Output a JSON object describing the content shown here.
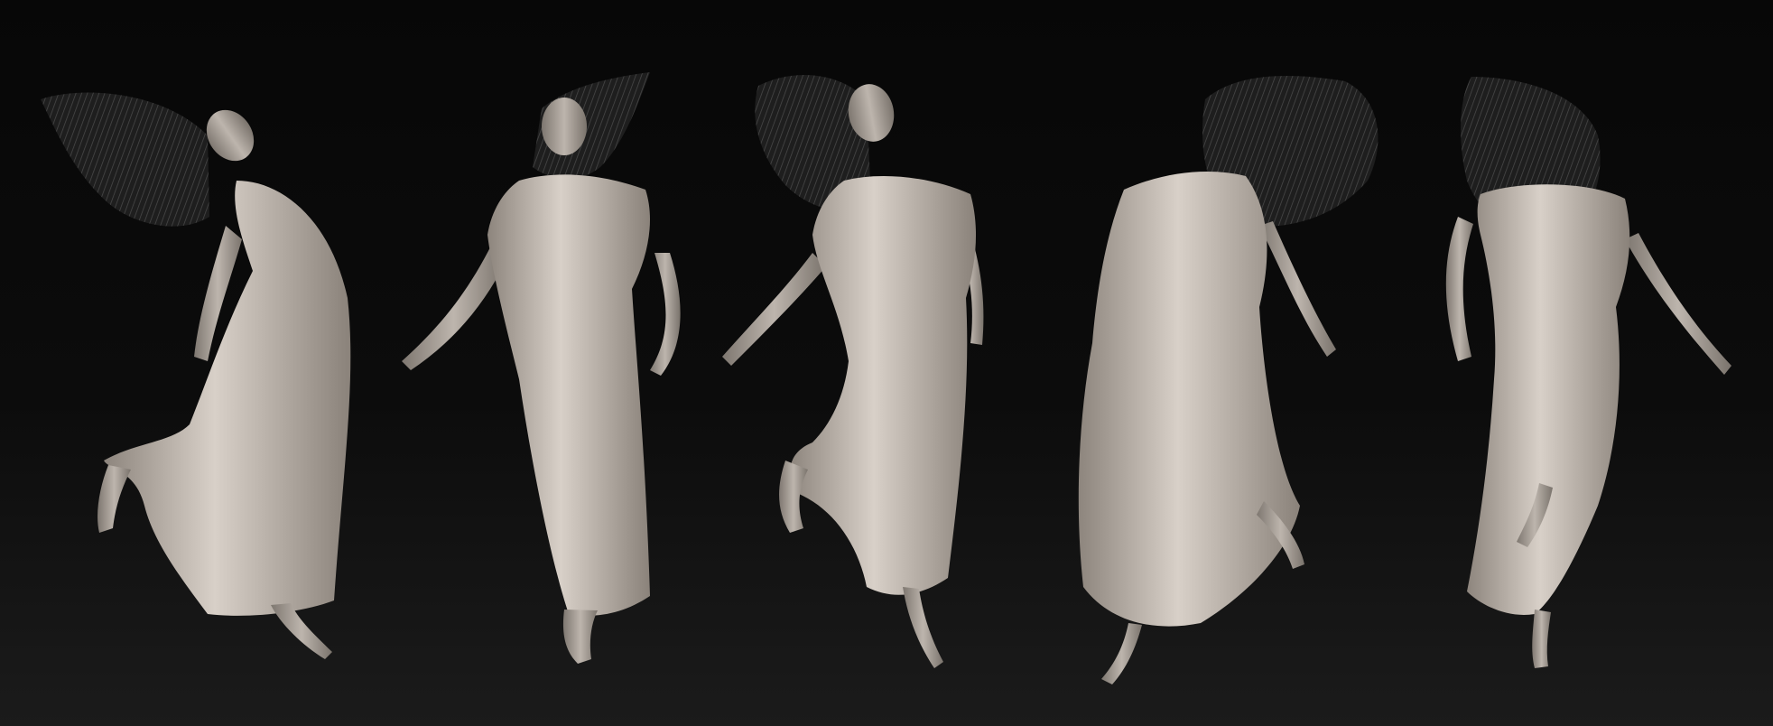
{
  "scene": {
    "background_top": "#070707",
    "background_bottom": "#1b1b1b",
    "cloth_color": "#cfc7bf",
    "cloth_shadow": "#8d857d",
    "skin_color": "#b9b1a9",
    "hair_color": "#2a2a2a",
    "figure_count": 5,
    "figures": [
      {
        "view": "side-left",
        "hair_flow": "left"
      },
      {
        "view": "front",
        "hair_flow": "right"
      },
      {
        "view": "front-three-quarter",
        "hair_flow": "left"
      },
      {
        "view": "back-three-quarter",
        "hair_flow": "right"
      },
      {
        "view": "back",
        "hair_flow": "up"
      }
    ]
  }
}
